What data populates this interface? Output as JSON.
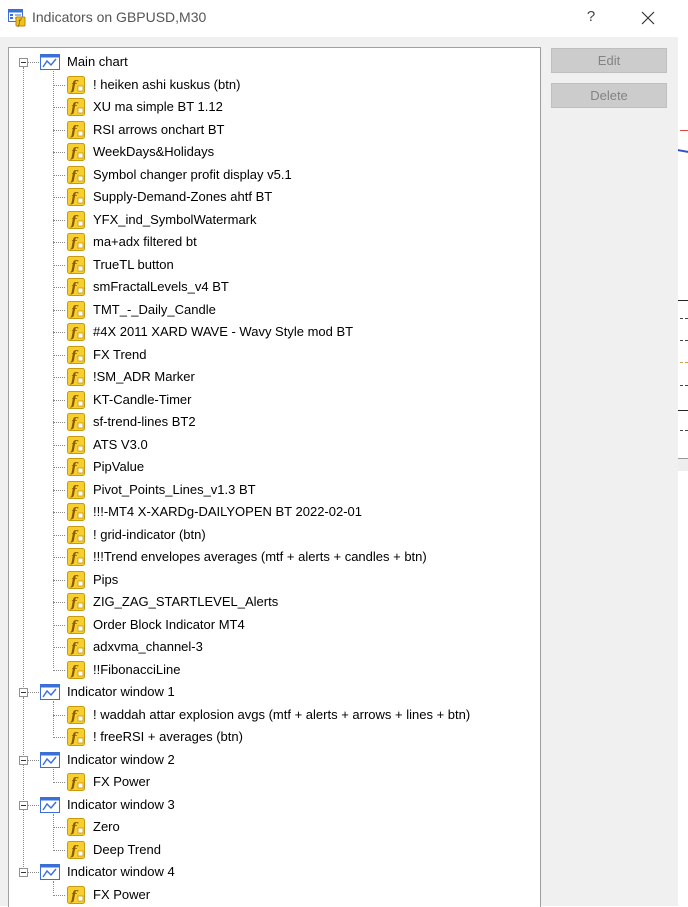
{
  "window": {
    "title": "Indicators on GBPUSD,M30",
    "help_label": "?"
  },
  "buttons": {
    "edit": "Edit",
    "delete": "Delete"
  },
  "tree": [
    {
      "label": "Main chart",
      "items": [
        "! heiken ashi kuskus (btn)",
        "XU ma simple BT 1.12",
        "RSI arrows onchart BT",
        "WeekDays&Holidays",
        "Symbol changer profit display v5.1",
        "Supply-Demand-Zones ahtf BT",
        "YFX_ind_SymbolWatermark",
        "ma+adx filtered bt",
        "TrueTL button",
        "smFractalLevels_v4 BT",
        "TMT_-_Daily_Candle",
        "#4X 2011 XARD WAVE - Wavy Style mod BT",
        "FX Trend",
        "!SM_ADR Marker",
        "KT-Candle-Timer",
        "sf-trend-lines BT2",
        "ATS V3.0",
        "PipValue",
        "Pivot_Points_Lines_v1.3 BT",
        "!!!-MT4 X-XARDg-DAILYOPEN BT 2022-02-01",
        "! grid-indicator (btn)",
        "!!!Trend envelopes averages (mtf + alerts + candles + btn)",
        "Pips",
        "ZIG_ZAG_STARTLEVEL_Alerts",
        "Order Block Indicator MT4",
        "adxvma_channel-3",
        "!!FibonacciLine"
      ]
    },
    {
      "label": "Indicator window 1",
      "items": [
        "! waddah attar explosion avgs  (mtf + alerts + arrows + lines + btn)",
        "! freeRSI + averages (btn)"
      ]
    },
    {
      "label": "Indicator window 2",
      "items": [
        "FX Power"
      ]
    },
    {
      "label": "Indicator window 3",
      "items": [
        "Zero",
        "Deep Trend"
      ]
    },
    {
      "label": "Indicator window 4",
      "items": [
        "FX Power"
      ]
    }
  ],
  "colors": {
    "window_icon_blue": "#3a6fd8",
    "indicator_icon_gold": "#f2c21b",
    "button_bg": "#cccccc",
    "button_text": "#838383"
  }
}
